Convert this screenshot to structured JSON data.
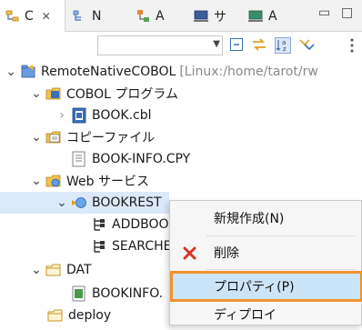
{
  "tabs": [
    {
      "label": "C",
      "icon": "project-explorer-icon",
      "active": true
    },
    {
      "label": "N",
      "icon": "navigator-icon"
    },
    {
      "label": "A",
      "icon": "outline-icon"
    },
    {
      "label": "サ",
      "icon": "server-icon"
    },
    {
      "label": "A",
      "icon": "application-icon"
    }
  ],
  "tree": {
    "project": {
      "label": "RemoteNativeCOBOL",
      "suffix": "[Linux:/home/tarot/rw"
    },
    "cobol_folder": "COBOL プログラム",
    "cobol_file": "BOOK.cbl",
    "copy_folder": "コピーファイル",
    "copy_file": "BOOK-INFO.CPY",
    "web_folder": "Web サービス",
    "service": "BOOKREST",
    "op1": "ADDBOO",
    "op2": "SEARCHE",
    "dat_folder": "DAT",
    "dat_file": "BOOKINFO.",
    "deploy_folder": "deploy"
  },
  "context_menu": {
    "items": [
      {
        "label": "新規作成(N)"
      },
      {
        "label": "削除",
        "icon": "delete-x-icon"
      },
      {
        "label": "プロパティ(P)",
        "highlighted": true
      },
      {
        "label": "ディプロイ"
      }
    ]
  },
  "colors": {
    "highlight_border": "#f0922e",
    "selection": "#dbe9fa",
    "delete_red": "#d9342b"
  }
}
